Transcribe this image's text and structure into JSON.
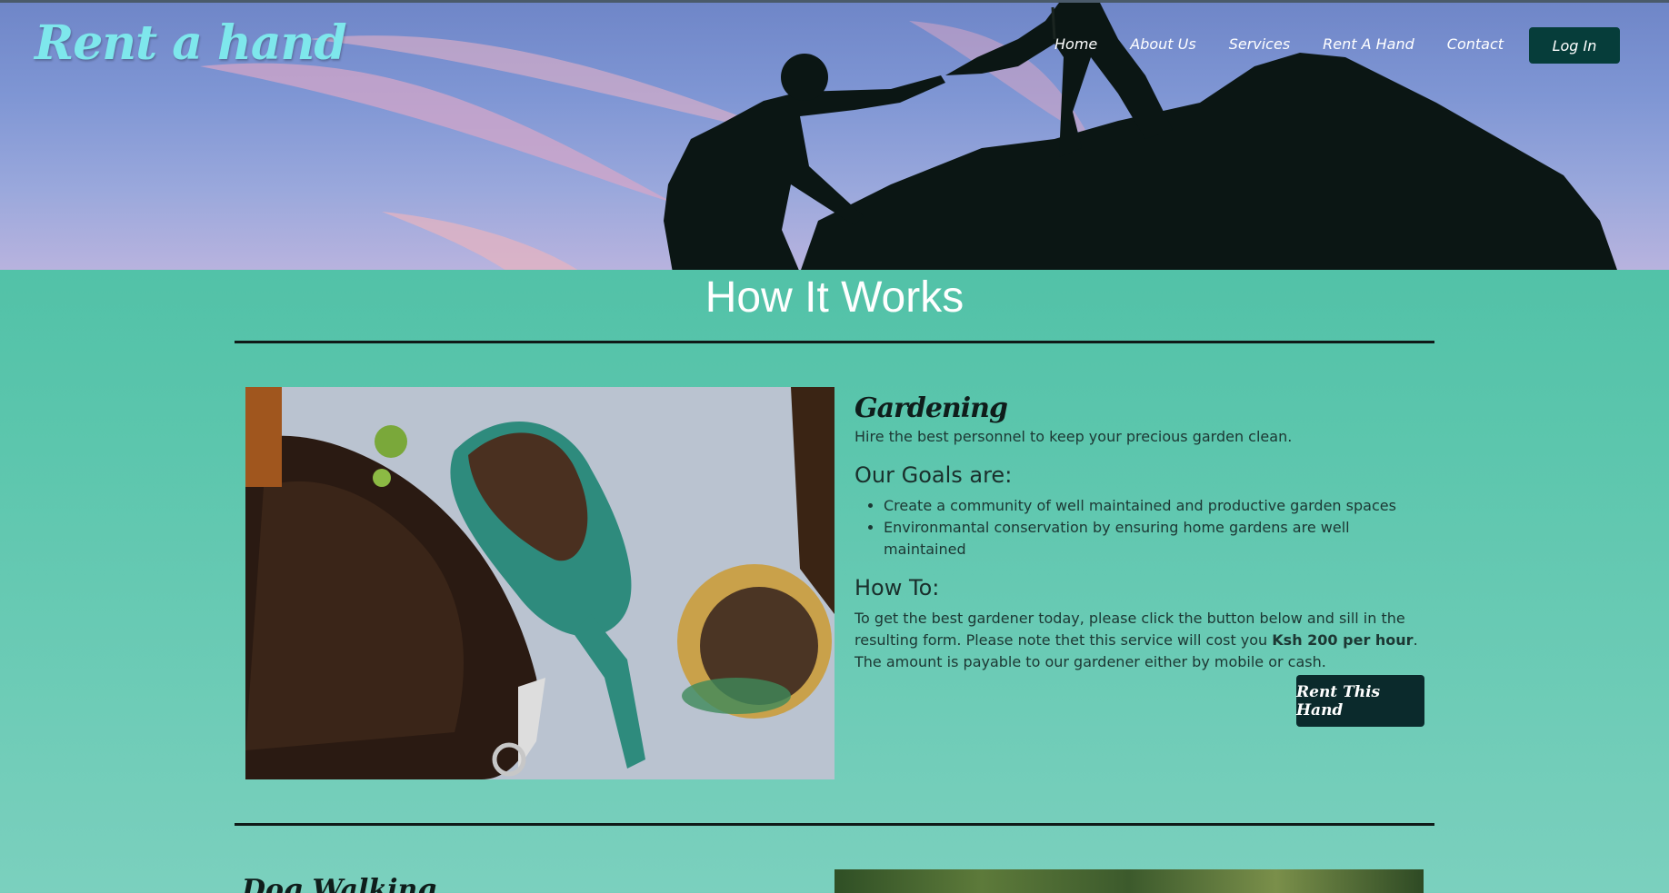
{
  "brand": {
    "logo": "Rent a hand"
  },
  "nav": {
    "items": [
      "Home",
      "About Us",
      "Services",
      "Rent A Hand",
      "Contact"
    ],
    "login": "Log In"
  },
  "section": {
    "title": "How It Works"
  },
  "gardening": {
    "heading": "Gardening",
    "intro": "Hire the best personnel to keep your precious garden clean.",
    "goals_heading": "Our Goals are:",
    "goals": [
      "Create a community of well maintained and productive garden spaces",
      "Environmantal conservation by ensuring home gardens are well maintained"
    ],
    "howto_heading": "How To:",
    "howto_before": "To get the best gardener today, please click the button below and sill in the resulting form. Please note thet this service will cost you ",
    "howto_price": "Ksh 200 per hour",
    "howto_after": ". The amount is payable to our gardener either by mobile or cash.",
    "button": "Rent This Hand"
  },
  "next": {
    "heading": "Dog Walking"
  },
  "colors": {
    "accent": "#43bb9f",
    "button_dark": "#0b2a2c",
    "logo": "#7ee7ec"
  }
}
